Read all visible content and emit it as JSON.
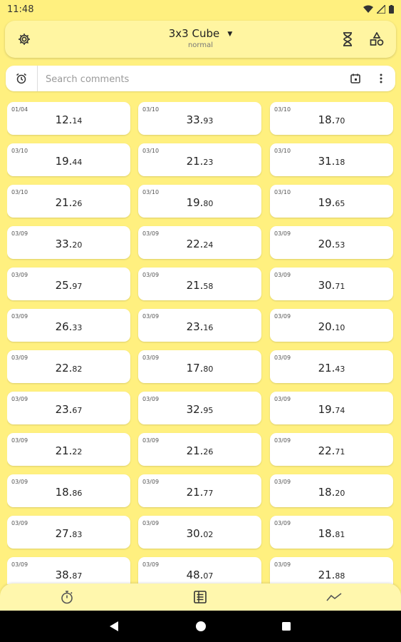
{
  "status_bar": {
    "time": "11:48"
  },
  "header": {
    "title": "3x3 Cube",
    "subtitle": "normal",
    "icons": [
      "gear-icon",
      "hourglass-icon",
      "shapes-icon",
      "chevron-down-icon"
    ]
  },
  "search": {
    "placeholder": "Search comments",
    "icons": [
      "alarm-clock-icon",
      "calendar-icon",
      "more-vertical-icon"
    ]
  },
  "solves": [
    {
      "date": "01/04",
      "whole": "12.",
      "dec": "14"
    },
    {
      "date": "03/10",
      "whole": "33.",
      "dec": "93"
    },
    {
      "date": "03/10",
      "whole": "18.",
      "dec": "70"
    },
    {
      "date": "03/10",
      "whole": "19.",
      "dec": "44"
    },
    {
      "date": "03/10",
      "whole": "21.",
      "dec": "23"
    },
    {
      "date": "03/10",
      "whole": "31.",
      "dec": "18"
    },
    {
      "date": "03/10",
      "whole": "21.",
      "dec": "26"
    },
    {
      "date": "03/10",
      "whole": "19.",
      "dec": "80"
    },
    {
      "date": "03/10",
      "whole": "19.",
      "dec": "65"
    },
    {
      "date": "03/09",
      "whole": "33.",
      "dec": "20"
    },
    {
      "date": "03/09",
      "whole": "22.",
      "dec": "24"
    },
    {
      "date": "03/09",
      "whole": "20.",
      "dec": "53"
    },
    {
      "date": "03/09",
      "whole": "25.",
      "dec": "97"
    },
    {
      "date": "03/09",
      "whole": "21.",
      "dec": "58"
    },
    {
      "date": "03/09",
      "whole": "30.",
      "dec": "71"
    },
    {
      "date": "03/09",
      "whole": "26.",
      "dec": "33"
    },
    {
      "date": "03/09",
      "whole": "23.",
      "dec": "16"
    },
    {
      "date": "03/09",
      "whole": "20.",
      "dec": "10"
    },
    {
      "date": "03/09",
      "whole": "22.",
      "dec": "82"
    },
    {
      "date": "03/09",
      "whole": "17.",
      "dec": "80"
    },
    {
      "date": "03/09",
      "whole": "21.",
      "dec": "43"
    },
    {
      "date": "03/09",
      "whole": "23.",
      "dec": "67"
    },
    {
      "date": "03/09",
      "whole": "32.",
      "dec": "95"
    },
    {
      "date": "03/09",
      "whole": "19.",
      "dec": "74"
    },
    {
      "date": "03/09",
      "whole": "21.",
      "dec": "22"
    },
    {
      "date": "03/09",
      "whole": "21.",
      "dec": "26"
    },
    {
      "date": "03/09",
      "whole": "22.",
      "dec": "71"
    },
    {
      "date": "03/09",
      "whole": "18.",
      "dec": "86"
    },
    {
      "date": "03/09",
      "whole": "21.",
      "dec": "77"
    },
    {
      "date": "03/09",
      "whole": "18.",
      "dec": "20"
    },
    {
      "date": "03/09",
      "whole": "27.",
      "dec": "83"
    },
    {
      "date": "03/09",
      "whole": "30.",
      "dec": "02"
    },
    {
      "date": "03/09",
      "whole": "18.",
      "dec": "81"
    },
    {
      "date": "03/09",
      "whole": "38.",
      "dec": "87"
    },
    {
      "date": "03/09",
      "whole": "48.",
      "dec": "07"
    },
    {
      "date": "03/09",
      "whole": "21.",
      "dec": "88"
    }
  ],
  "bottom_nav": {
    "icons": [
      "stopwatch-icon",
      "list-icon",
      "trend-chart-icon"
    ],
    "active": "list-icon"
  },
  "colors": {
    "background": "#fff07f",
    "card": "#ffffff",
    "header": "#fff5a1",
    "system_nav": "#000000"
  }
}
